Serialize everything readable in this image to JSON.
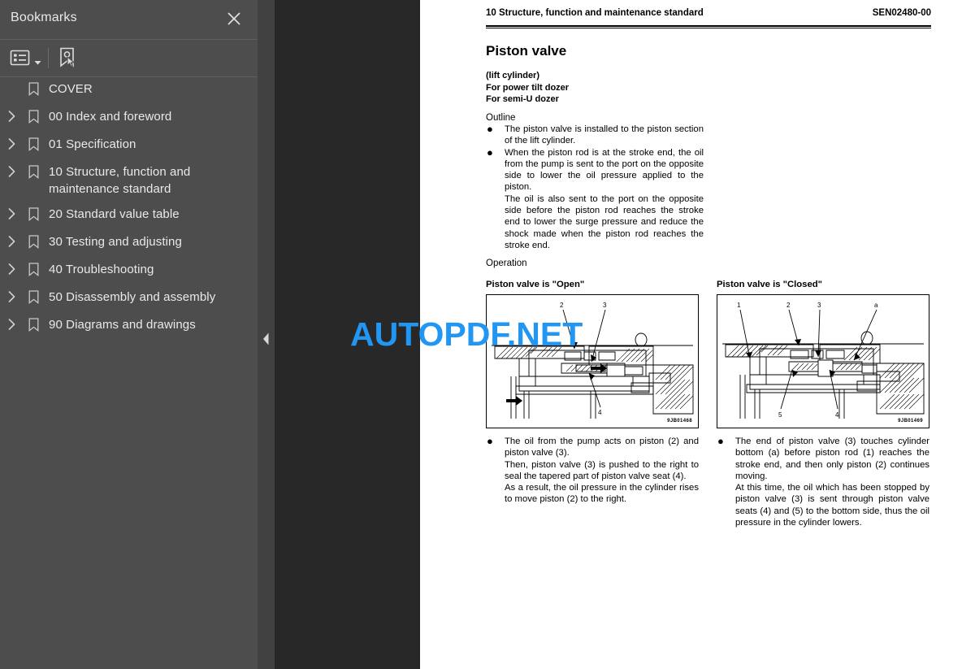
{
  "sidebar": {
    "title": "Bookmarks",
    "close_icon": "close-icon",
    "toolbar": {
      "options_icon": "list-options-icon",
      "caret_icon": "chevron-down-icon",
      "new_bookmark_icon": "new-bookmark-icon"
    },
    "items": [
      {
        "label": "COVER",
        "expandable": false
      },
      {
        "label": "00 Index and foreword",
        "expandable": true
      },
      {
        "label": "01 Specification",
        "expandable": true
      },
      {
        "label": "10 Structure, function and maintenance standard",
        "expandable": true
      },
      {
        "label": "20 Standard value table",
        "expandable": true
      },
      {
        "label": "30 Testing and adjusting",
        "expandable": true
      },
      {
        "label": "40 Troubleshooting",
        "expandable": true
      },
      {
        "label": "50 Disassembly and assembly",
        "expandable": true
      },
      {
        "label": "90 Diagrams and drawings",
        "expandable": true
      }
    ]
  },
  "viewer": {
    "collapse_icon": "collapse-left-icon",
    "watermark": "AUTOPDF.NET",
    "watermark_color": "#2196f3"
  },
  "page": {
    "header_left": "10 Structure, function and maintenance standard",
    "header_right": "SEN02480-00",
    "title": "Piston valve",
    "subtitles": [
      "(lift cylinder)",
      "For power tilt dozer",
      "For semi-U dozer"
    ],
    "outline_heading": "Outline",
    "outline_bullets": [
      [
        "The piston valve is installed to the piston section of the lift cylinder."
      ],
      [
        "When the piston rod is at the stroke end, the oil from the pump is sent to the port on the opposite side to lower the oil pressure applied to the piston.",
        "The oil is also sent to the port on the opposite side before the piston rod reaches the stroke end to lower the surge pressure and reduce the shock made when the piston rod reaches the stroke end."
      ]
    ],
    "operation_heading": "Operation",
    "figures": [
      {
        "caption": "Piston valve is \"Open\"",
        "code": "9JB01468",
        "callouts": [
          "2",
          "3",
          "4"
        ],
        "note": [
          "The oil from the pump acts on piston (2) and piston valve (3).",
          "Then, piston valve (3) is pushed to the right to seal the tapered part of piston valve seat (4).",
          "As a result, the oil pressure in the cylinder rises to move piston (2) to the right."
        ]
      },
      {
        "caption": "Piston valve is \"Closed\"",
        "code": "9JB01469",
        "callouts": [
          "1",
          "2",
          "3",
          "a",
          "5",
          "4"
        ],
        "note": [
          "The end of piston valve (3) touches cylinder bottom (a) before piston rod (1) reaches the stroke end, and then only piston (2) continues moving.",
          "At this time, the oil which has been stopped by piston valve (3) is sent through piston valve seats (4) and (5) to the bottom side, thus the oil pressure in the cylinder lowers."
        ]
      }
    ],
    "bullet_glyph": "●"
  }
}
